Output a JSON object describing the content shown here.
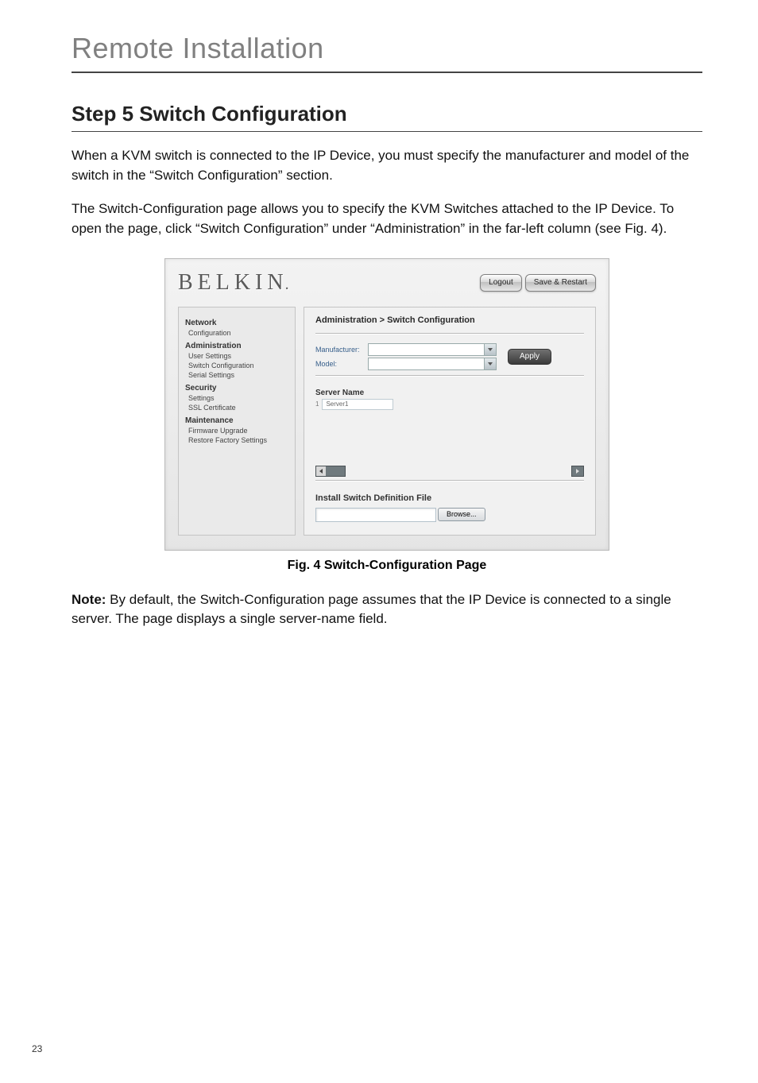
{
  "chapter_title": "Remote Installation",
  "step_heading": "Step 5   Switch Configuration",
  "para1": "When a KVM switch is connected to the IP Device, you must specify the manufacturer and model of the switch in the “Switch Configuration” section.",
  "para2": "The Switch-Configuration page allows you to specify the KVM Switches attached to the IP Device. To open the page, click “Switch Configuration” under “Administration” in the far-left column (see Fig. 4).",
  "figure": {
    "brand": "BELKIN",
    "top_buttons": {
      "logout": "Logout",
      "save_restart": "Save & Restart"
    },
    "sidebar": [
      {
        "title": "Network",
        "items": [
          "Configuration"
        ]
      },
      {
        "title": "Administration",
        "items": [
          "User Settings",
          "Switch Configuration",
          "Serial Settings"
        ]
      },
      {
        "title": "Security",
        "items": [
          "Settings",
          "SSL Certificate"
        ]
      },
      {
        "title": "Maintenance",
        "items": [
          "Firmware Upgrade",
          "Restore Factory Settings"
        ]
      }
    ],
    "breadcrumb": "Administration > Switch Configuration",
    "form": {
      "manufacturer_label": "Manufacturer:",
      "model_label": "Model:",
      "apply": "Apply",
      "server_name_heading": "Server Name",
      "servers": [
        {
          "num": "1",
          "value": "Server1"
        }
      ],
      "install_heading": "Install Switch Definition File",
      "browse": "Browse..."
    }
  },
  "fig_caption": "Fig. 4 Switch-Configuration Page",
  "note_label": "Note:",
  "note_text": " By default, the Switch-Configuration page assumes that the IP Device is connected to a single server. The page displays a single server-name field.",
  "page_number": "23"
}
